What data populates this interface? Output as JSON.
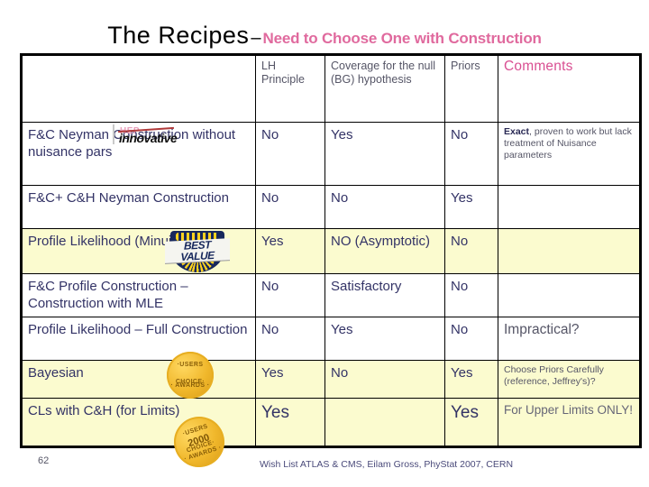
{
  "title": {
    "main": "The Recipes",
    "dash": "–",
    "subtitle": "Need to Choose One with Construction"
  },
  "table": {
    "headers": {
      "method": "",
      "lh": "LH Principle",
      "coverage": "Coverage for the null (BG) hypothesis",
      "priors": "Priors",
      "comments": "Comments"
    },
    "rows": [
      {
        "method": "F&C Neyman Construction without  nuisance pars",
        "lh": "No",
        "coverage": "Yes",
        "priors": "No",
        "comment_bold": "Exact",
        "comment_rest": ", proven to work but lack treatment of Nuisance parameters",
        "shade": "white"
      },
      {
        "method": "F&C+ C&H Neyman Construction",
        "lh": "No",
        "coverage": "No",
        "priors": "Yes",
        "comment": "",
        "shade": "white"
      },
      {
        "method": "Profile Likelihood  (Minuit)",
        "lh": "Yes",
        "coverage": "NO (Asymptotic)",
        "priors": "No",
        "comment": "",
        "shade": "yellow"
      },
      {
        "method": "F&C Profile Construction – Construction with MLE",
        "lh": "No",
        "coverage": "Satisfactory",
        "priors": "No",
        "comment": "",
        "shade": "white"
      },
      {
        "method": "Profile Likelihood – Full Construction",
        "lh": "No",
        "coverage": "Yes",
        "priors": "No",
        "comment": "Impractical?",
        "shade": "white"
      },
      {
        "method": "Bayesian",
        "lh": "Yes",
        "coverage": "No",
        "priors": "Yes",
        "comment": "Choose Priors Carefully (reference, Jeffrey's)?",
        "shade": "yellow"
      },
      {
        "method": "CLs with C&H (for Limits)",
        "lh": "Yes",
        "coverage": "",
        "priors": "Yes",
        "comment": "For Upper Limits ONLY!",
        "shade": "yellow"
      }
    ]
  },
  "badges": {
    "hep": {
      "top_word": "HEP",
      "main_word": "innovative"
    },
    "best_value": {
      "line1": "BEST",
      "line2": "VALUE"
    },
    "seal1": {
      "ring_top": "·USERS CHOICE·",
      "ring_bottom": "· AWARDS ·",
      "year": ""
    },
    "seal2": {
      "ring_top": "·USERS CHOICE·",
      "ring_bottom": "· AWARDS ·",
      "year": "2000"
    }
  },
  "footer": {
    "note": "Wish List ATLAS & CMS, Eilam Gross, PhyStat 2007, CERN",
    "page_number": "62"
  },
  "colors": {
    "accent_pink": "#d94f92",
    "text_navy": "#333366",
    "row_yellow": "#fbfbcf",
    "gold": "#f0b72b"
  }
}
